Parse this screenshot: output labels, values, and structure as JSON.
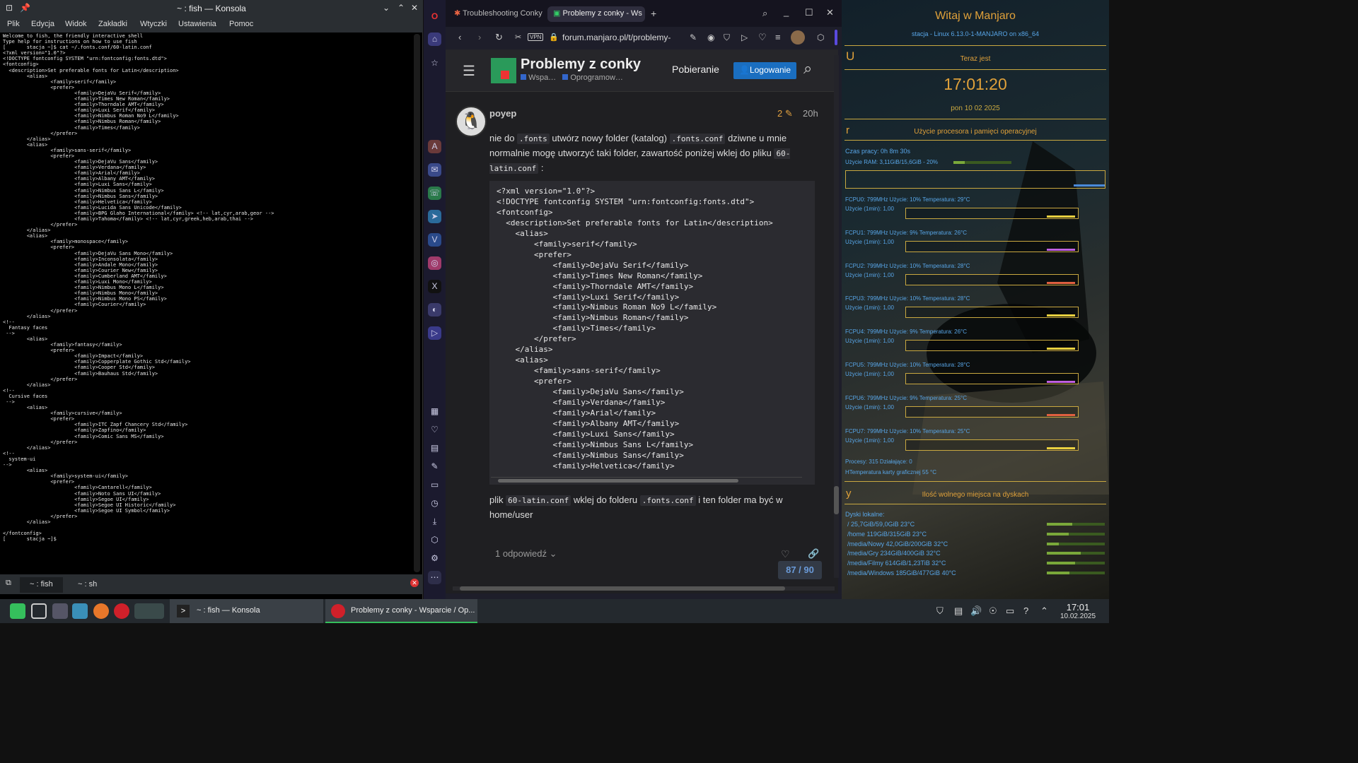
{
  "konsola": {
    "title": "~ : fish — Konsola",
    "menu": [
      "Plik",
      "Edycja",
      "Widok",
      "Zakładki",
      "Wtyczki",
      "Ustawienia",
      "Pomoc"
    ],
    "terminal_text": "Welcome to fish, the friendly interactive shell\nType help for instructions on how to use fish\n[       stacja ~]$ cat ~/.fonts.conf/60-latin.conf\n<?xml version=\"1.0\"?>\n<!DOCTYPE fontconfig SYSTEM \"urn:fontconfig:fonts.dtd\">\n<fontconfig>\n  <description>Set preferable fonts for Latin</description>\n        <alias>\n                <family>serif</family>\n                <prefer>\n                        <family>DejaVu Serif</family>\n                        <family>Times New Roman</family>\n                        <family>Thorndale AMT</family>\n                        <family>Luxi Serif</family>\n                        <family>Nimbus Roman No9 L</family>\n                        <family>Nimbus Roman</family>\n                        <family>Times</family>\n                </prefer>\n        </alias>\n        <alias>\n                <family>sans-serif</family>\n                <prefer>\n                        <family>DejaVu Sans</family>\n                        <family>Verdana</family>\n                        <family>Arial</family>\n                        <family>Albany AMT</family>\n                        <family>Luxi Sans</family>\n                        <family>Nimbus Sans L</family>\n                        <family>Nimbus Sans</family>\n                        <family>Helvetica</family>\n                        <family>Lucida Sans Unicode</family>\n                        <family>BPG Glaho International</family> <!-- lat,cyr,arab,geor -->\n                        <family>Tahoma</family> <!-- lat,cyr,greek,heb,arab,thai -->\n                </prefer>\n        </alias>\n        <alias>\n                <family>monospace</family>\n                <prefer>\n                        <family>DejaVu Sans Mono</family>\n                        <family>Inconsolata</family>\n                        <family>Andale Mono</family>\n                        <family>Courier New</family>\n                        <family>Cumberland AMT</family>\n                        <family>Luxi Mono</family>\n                        <family>Nimbus Mono L</family>\n                        <family>Nimbus Mono</family>\n                        <family>Nimbus Mono PS</family>\n                        <family>Courier</family>\n                </prefer>\n        </alias>\n<!--\n  Fantasy faces\n -->\n        <alias>\n                <family>fantasy</family>\n                <prefer>\n                        <family>Impact</family>\n                        <family>Copperplate Gothic Std</family>\n                        <family>Cooper Std</family>\n                        <family>Bauhaus Std</family>\n                </prefer>\n        </alias>\n<!--\n  Cursive faces\n -->\n        <alias>\n                <family>cursive</family>\n                <prefer>\n                        <family>ITC Zapf Chancery Std</family>\n                        <family>Zapfino</family>\n                        <family>Comic Sans MS</family>\n                </prefer>\n        </alias>\n<!--\n  system-ui\n-->\n        <alias>\n                <family>system-ui</family>\n                <prefer>\n                        <family>Cantarell</family>\n                        <family>Noto Sans UI</family>\n                        <family>Segoe UI</family>\n                        <family>Segoe UI Historic</family>\n                        <family>Segoe UI Symbol</family>\n                </prefer>\n        </alias>\n\n</fontconfig>\n[       stacja ~]$ ",
    "tabs": [
      "~ : fish",
      "~ : sh"
    ]
  },
  "browser": {
    "tabs": [
      "Troubleshooting Conky",
      "Problemy z conky - Ws"
    ],
    "url": "forum.manjaro.pl/t/problemy-",
    "vpn": "VPN",
    "topic_title": "Problemy z conky",
    "category1": "Wspa…",
    "category2": "Oprogramow…",
    "nav_download": "Pobieranie",
    "login": "Logowanie",
    "post": {
      "author": "poyep",
      "edits": "2",
      "age": "20h",
      "p1_a": "nie do ",
      "p1_code1": ".fonts",
      "p1_b": " utwórz nowy folder (katalog) ",
      "p1_code2": ".fonts.conf",
      "p1_c": " dziwne u mnie normalnie mogę utworzyć taki folder, zawartość poniżej wklej do pliku ",
      "p1_code3": "60-latin.conf",
      "p1_d": " :",
      "code": "<?xml version=\"1.0\"?>\n<!DOCTYPE fontconfig SYSTEM \"urn:fontconfig:fonts.dtd\">\n<fontconfig>\n  <description>Set preferable fonts for Latin</description>\n    <alias>\n        <family>serif</family>\n        <prefer>\n            <family>DejaVu Serif</family>\n            <family>Times New Roman</family>\n            <family>Thorndale AMT</family>\n            <family>Luxi Serif</family>\n            <family>Nimbus Roman No9 L</family>\n            <family>Nimbus Roman</family>\n            <family>Times</family>\n        </prefer>\n    </alias>\n    <alias>\n        <family>sans-serif</family>\n        <prefer>\n            <family>DejaVu Sans</family>\n            <family>Verdana</family>\n            <family>Arial</family>\n            <family>Albany AMT</family>\n            <family>Luxi Sans</family>\n            <family>Nimbus Sans L</family>\n            <family>Nimbus Sans</family>\n            <family>Helvetica</family>",
      "p2_a": "plik ",
      "p2_code1": "60-latin.conf",
      "p2_b": " wklej do folderu ",
      "p2_code2": ".fonts.conf",
      "p2_c": " i ten folder ma być w home/user",
      "replies": "1 odpowiedź",
      "progress": "87 / 90"
    }
  },
  "conky": {
    "header": "Witaj w Manjaro",
    "system": "stacja - Linux 6.13.0-1-MANJARO on x86_64",
    "letter_u": "U",
    "now_label": "Teraz jest",
    "time": "17:01:20",
    "date": "pon 10 02 2025",
    "letter_r": "r",
    "cpu_title": "Użycie procesora i pamięci operacyjnej",
    "uptime": "Czas pracy: 0h 8m 30s",
    "ram": "Użycie RAM: 3,11GiB/15,6GiB - 20%",
    "ram_fraction": 0.2,
    "cpus": [
      {
        "line1": "FCPU0: 799MHz Użycie: 10% Temperatura: 29°C",
        "line2": "Użycie (1min): 1,00",
        "color": "#e8d040"
      },
      {
        "line1": "FCPU1: 799MHz Użycie: 9% Temperatura: 26°C",
        "line2": "Użycie (1min): 1,00",
        "color": "#c060e0"
      },
      {
        "line1": "FCPU2: 799MHz Użycie: 10% Temperatura: 28°C",
        "line2": "Użycie (1min): 1,00",
        "color": "#e06040"
      },
      {
        "line1": "FCPU3: 799MHz Użycie: 10% Temperatura: 28°C",
        "line2": "Użycie (1min): 1,00",
        "color": "#e8d040"
      },
      {
        "line1": "FCPU4: 799MHz Użycie: 9% Temperatura: 26°C",
        "line2": "Użycie (1min): 1,00",
        "color": "#e8d040"
      },
      {
        "line1": "FCPU5: 799MHz Użycie: 10% Temperatura: 28°C",
        "line2": "Użycie (1min): 1,00",
        "color": "#c060e0"
      },
      {
        "line1": "FCPU6: 799MHz Użycie: 9% Temperatura: 25°C",
        "line2": "Użycie (1min): 1,00",
        "color": "#e06040"
      },
      {
        "line1": "FCPU7: 799MHz Użycie: 10% Temperatura: 25°C",
        "line2": "Użycie (1min): 1,00",
        "color": "#e8d040"
      }
    ],
    "processes": "Procesy: 315  Działające: 0",
    "gpu_temp": "HTemperatura karty graficznej 55 °C",
    "letter_y": "y",
    "disk_title": "Ilość wolnego miejsca na dyskach",
    "disk_label": "Dyski lokalne:",
    "disks": [
      {
        "text": "/ 25,7GiB/59,0GiB 23°C",
        "used": 0.44
      },
      {
        "text": "/home 119GiB/315GiB 23°C",
        "used": 0.38
      },
      {
        "text": "/media/Nowy 42,0GiB/200GiB 32°C",
        "used": 0.21
      },
      {
        "text": "/media/Gry 234GiB/400GiB 32°C",
        "used": 0.58
      },
      {
        "text": "/media/Filmy 614GiB/1,23TiB 32°C",
        "used": 0.49
      },
      {
        "text": "/media/Windows 185GiB/477GiB 40°C",
        "used": 0.39
      }
    ]
  },
  "taskbar": {
    "task1": "~ : fish — Konsola",
    "task2": "Problemy z conky - Wsparcie / Op...",
    "time": "17:01",
    "date": "10.02.2025"
  }
}
